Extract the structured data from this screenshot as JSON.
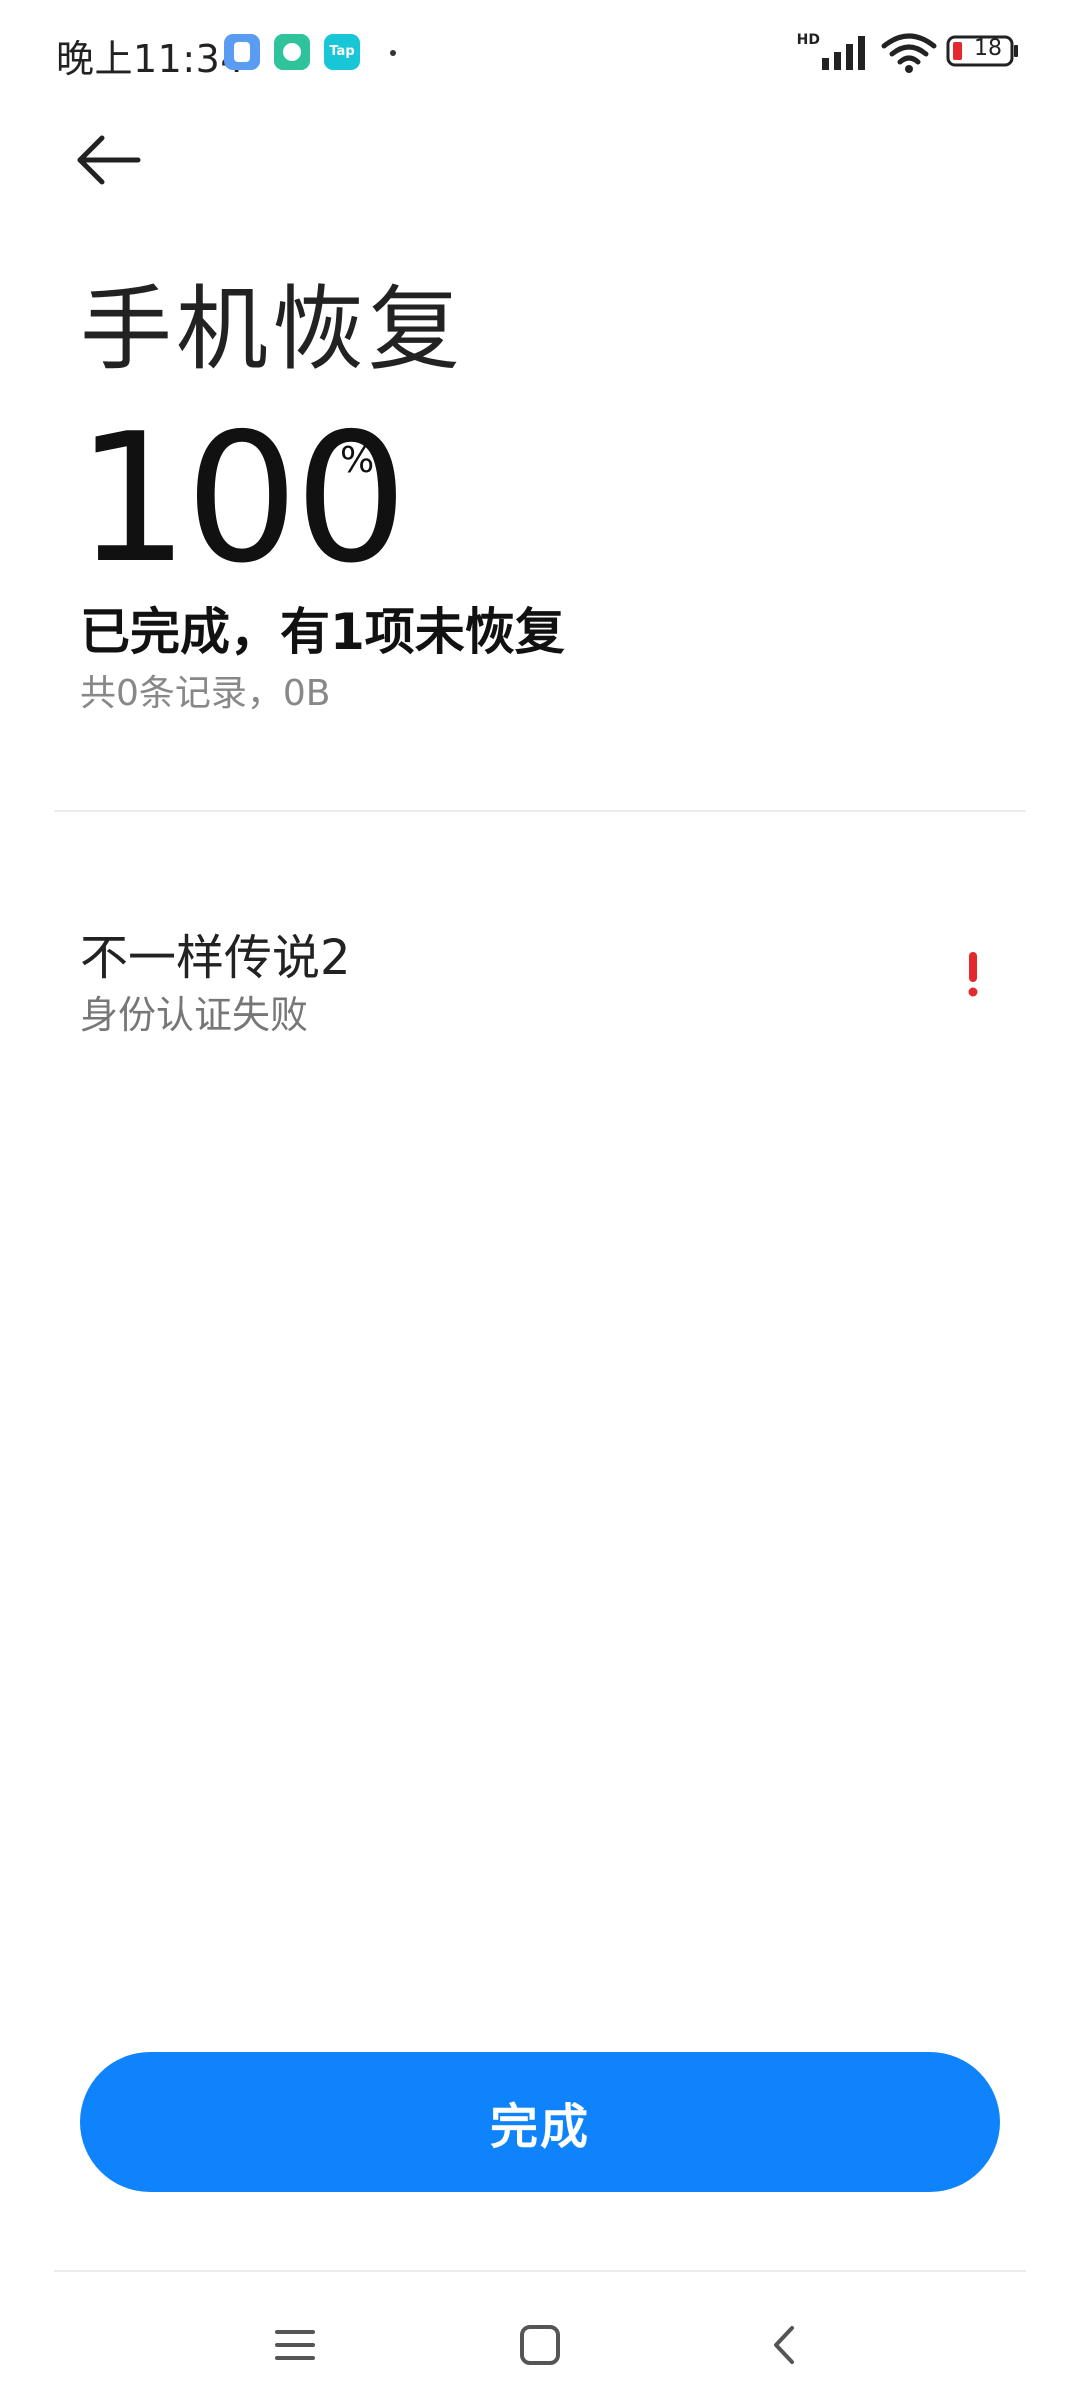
{
  "status_bar": {
    "time": "晚上11:34",
    "network_label": "HD",
    "battery_level": "18",
    "icons": [
      "notes-app-icon",
      "security-app-icon",
      "taptap-app-icon",
      "signal-icon",
      "wifi-icon",
      "battery-icon"
    ],
    "taptap_label": "Tap"
  },
  "header": {
    "title": "手机恢复"
  },
  "progress": {
    "value": "100",
    "unit": "%",
    "status_text": "已完成，有1项未恢复",
    "summary_text": "共0条记录，0B"
  },
  "items": [
    {
      "name": "不一样传说2",
      "status": "身份认证失败",
      "state_icon": "error-exclamation-icon",
      "state_color": "#e5272e"
    }
  ],
  "actions": {
    "done_label": "完成",
    "accent_color": "#0f83fb"
  }
}
